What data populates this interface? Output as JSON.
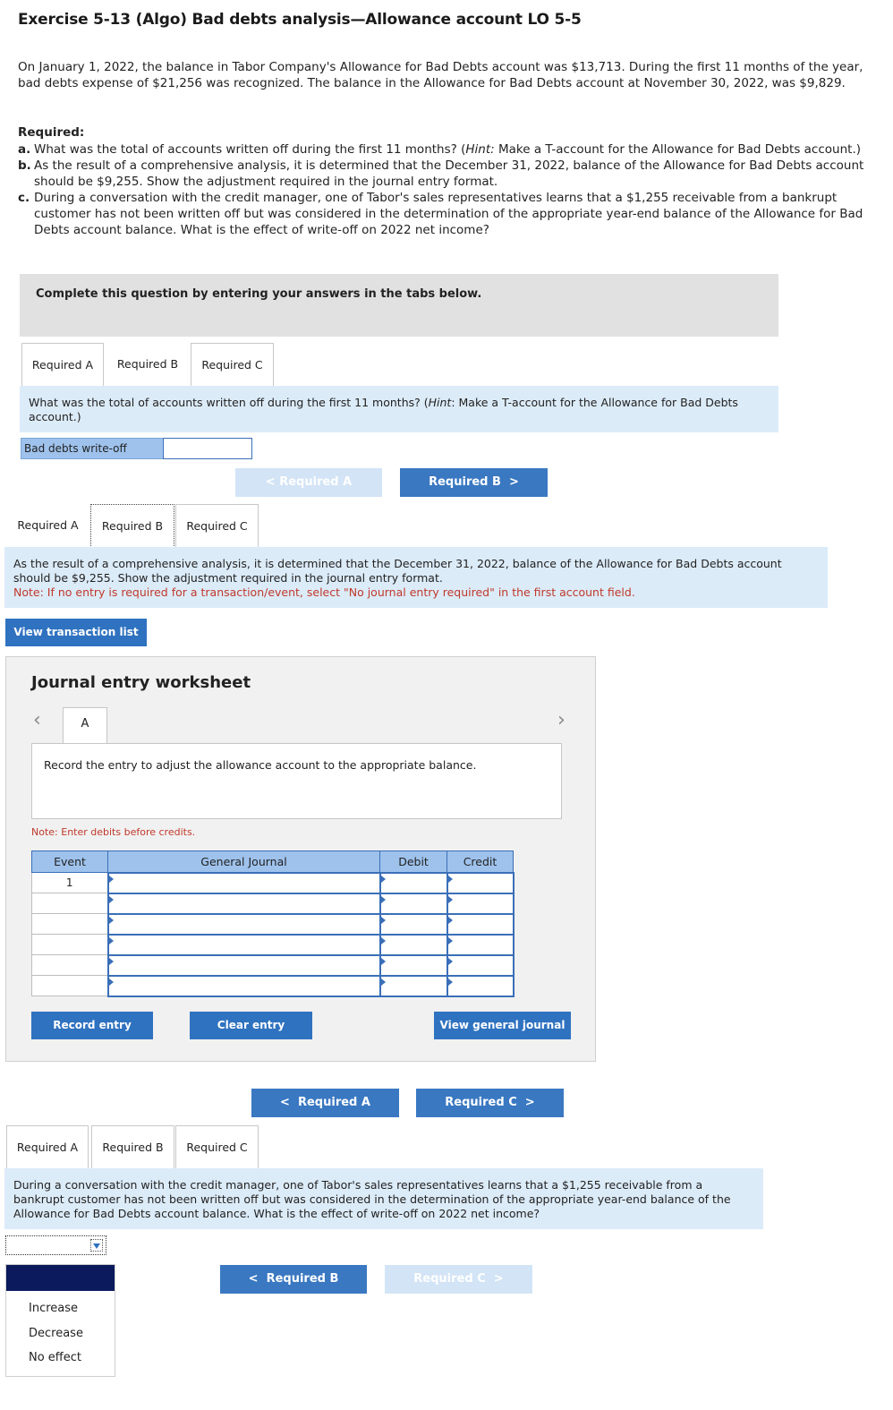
{
  "title": "Exercise 5-13 (Algo) Bad debts analysis—Allowance account LO 5-5",
  "intro": "On January 1, 2022, the balance in Tabor Company's Allowance for Bad Debts account was $13,713. During the first 11 months of the year, bad debts expense of $21,256 was recognized. The balance in the Allowance for Bad Debts account at November 30, 2022, was $9,829.",
  "required_heading": "Required:",
  "required": {
    "a_letter": "a.",
    "a_text_1": "What was the total of accounts written off during the first 11 months? (",
    "a_hint": "Hint:",
    "a_text_2": " Make a T-account for the Allowance for Bad Debts account.)",
    "b_letter": "b.",
    "b_text": "As the result of a comprehensive analysis, it is determined that the December 31, 2022, balance of the Allowance for Bad Debts account should be $9,255. Show the adjustment required in the journal entry format.",
    "c_letter": "c.",
    "c_text": "During a conversation with the credit manager, one of Tabor's sales representatives learns that a $1,255 receivable from a bankrupt customer has not been written off but was considered in the determination of the appropriate year-end balance of the Allowance for Bad Debts account balance. What is the effect of write-off on 2022 net income?"
  },
  "banner": "Complete this question by entering your answers in the tabs below.",
  "tabs": {
    "a": "Required A",
    "b": "Required B",
    "c": "Required C"
  },
  "section_a": {
    "question_1": "What was the total of accounts written off during the first 11 months? (",
    "hint": "Hint",
    "question_2": ": Make a T-account for the Allowance for Bad Debts account.)",
    "field_label": "Bad debts write-off",
    "prev": "Required A",
    "next": "Required B"
  },
  "section_b": {
    "question": "As the result of a comprehensive analysis, it is determined that the December 31, 2022, balance of the Allowance for Bad Debts account should be $9,255. Show the adjustment required in the journal entry format.",
    "note": "Note: If no entry is required for a transaction/event, select \"No journal entry required\" in the first account field.",
    "view_transactions": "View transaction list",
    "worksheet_title": "Journal entry worksheet",
    "worksheet_tab": "A",
    "worksheet_desc": "Record the entry to adjust the allowance account to the appropriate balance.",
    "worksheet_note": "Note: Enter debits before credits.",
    "table_headers": {
      "event": "Event",
      "journal": "General Journal",
      "debit": "Debit",
      "credit": "Credit"
    },
    "first_event": "1",
    "record_btn": "Record entry",
    "clear_btn": "Clear entry",
    "view_journal_btn": "View general journal",
    "prev": "Required A",
    "next": "Required C"
  },
  "section_c": {
    "question": "During a conversation with the credit manager, one of Tabor's sales representatives learns that a $1,255 receivable from a bankrupt customer has not been written off but was considered in the determination of the appropriate year-end balance of the Allowance for Bad Debts account balance. What is the effect of write-off on 2022 net income?",
    "options": [
      "Increase",
      "Decrease",
      "No effect"
    ],
    "prev": "Required B",
    "next": "Required C"
  },
  "colors": {
    "accent": "#3a78c2",
    "question_bg": "#dcebf8",
    "note": "#c0392b",
    "header_cell": "#9ec2ec"
  }
}
